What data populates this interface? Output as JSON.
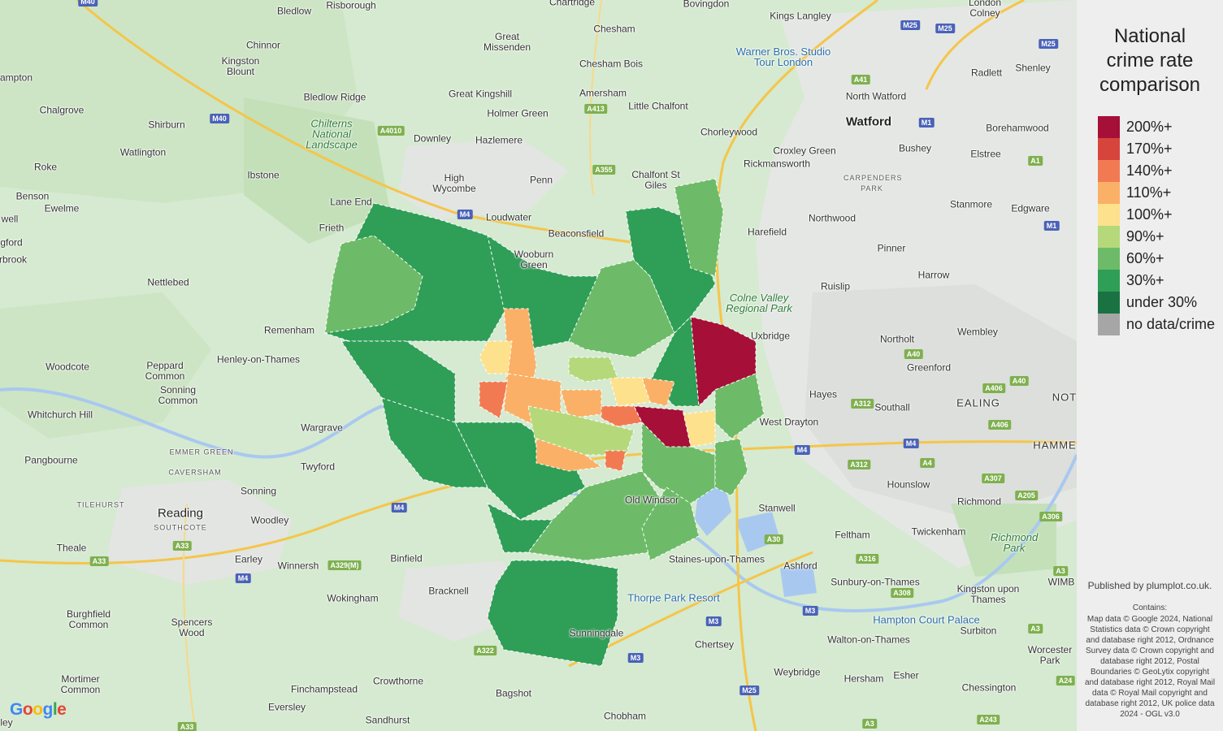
{
  "legend": {
    "title_lines": [
      "National",
      "crime rate",
      "comparison"
    ],
    "items": [
      {
        "label": "200%+",
        "color": "#a50f38"
      },
      {
        "label": "170%+",
        "color": "#d7443c"
      },
      {
        "label": "140%+",
        "color": "#f27a52"
      },
      {
        "label": "110%+",
        "color": "#fbb067"
      },
      {
        "label": "100%+",
        "color": "#fde18c"
      },
      {
        "label": "90%+",
        "color": "#b5d97a"
      },
      {
        "label": "60%+",
        "color": "#6dbb68"
      },
      {
        "label": "30%+",
        "color": "#2f9e57"
      },
      {
        "label": "under 30%",
        "color": "#1a7242"
      },
      {
        "label": "no data/crime",
        "color": "#a6a6a6"
      }
    ]
  },
  "published": "Published by plumplot.co.uk.",
  "contains_heading": "Contains:",
  "attribution": "Map data © Google 2024, National Statistics data © Crown copyright and database right 2012, Ordnance Survey data © Crown copyright and database right 2012, Postal Boundaries © GeoLytix copyright and database right 2012, Royal Mail data © Royal Mail copyright and database right 2012, UK police data 2024 - OGL v3.0",
  "google_logo": [
    "G",
    "o",
    "o",
    "g",
    "l",
    "e"
  ],
  "map_labels": [
    {
      "text": "Bledlow"
    },
    {
      "text": "Risborough"
    },
    {
      "text": "Chinnor"
    },
    {
      "text": "Kingston Blount"
    },
    {
      "text": "ampton"
    },
    {
      "text": "Chalgrove"
    },
    {
      "text": "Shirburn"
    },
    {
      "text": "Watlington"
    },
    {
      "text": "Roke"
    },
    {
      "text": "Benson"
    },
    {
      "text": "Ewelme"
    },
    {
      "text": "Ibstone"
    },
    {
      "text": "Bledlow Ridge"
    },
    {
      "text": "Great Missenden"
    },
    {
      "text": "Chesham"
    },
    {
      "text": "Chesham Bois"
    },
    {
      "text": "Amersham"
    },
    {
      "text": "Little Chalfont"
    },
    {
      "text": "Great Kingshill"
    },
    {
      "text": "Holmer Green"
    },
    {
      "text": "Hazlemere"
    },
    {
      "text": "Downley"
    },
    {
      "text": "High Wycombe"
    },
    {
      "text": "Penn"
    },
    {
      "text": "Lane End"
    },
    {
      "text": "Loudwater"
    },
    {
      "text": "Beaconsfield"
    },
    {
      "text": "Frieth"
    },
    {
      "text": "Wooburn Green"
    },
    {
      "text": "Chalfont St Giles"
    },
    {
      "text": "Chorleywood"
    },
    {
      "text": "Croxley Green"
    },
    {
      "text": "Rickmansworth"
    },
    {
      "text": "Watford"
    },
    {
      "text": "North Watford"
    },
    {
      "text": "Kings Langley"
    },
    {
      "text": "Bovingdon"
    },
    {
      "text": "Chartridge"
    },
    {
      "text": "Radlett"
    },
    {
      "text": "Shenley"
    },
    {
      "text": "Borehamwood"
    },
    {
      "text": "Bushey"
    },
    {
      "text": "Elstree"
    },
    {
      "text": "Stanmore"
    },
    {
      "text": "Edgware"
    },
    {
      "text": "Northwood"
    },
    {
      "text": "Harefield"
    },
    {
      "text": "Pinner"
    },
    {
      "text": "Harrow"
    },
    {
      "text": "Ruislip"
    },
    {
      "text": "Uxbridge"
    },
    {
      "text": "Northolt"
    },
    {
      "text": "Wembley"
    },
    {
      "text": "Greenford"
    },
    {
      "text": "Hayes"
    },
    {
      "text": "Southall"
    },
    {
      "text": "EALING"
    },
    {
      "text": "NOT"
    },
    {
      "text": "West Drayton"
    },
    {
      "text": "HAMME"
    },
    {
      "text": "Hounslow"
    },
    {
      "text": "Stanwell"
    },
    {
      "text": "Richmond"
    },
    {
      "text": "Feltham"
    },
    {
      "text": "Twickenham"
    },
    {
      "text": "Richmond Park"
    },
    {
      "text": "Ashford"
    },
    {
      "text": "Staines-upon-Thames"
    },
    {
      "text": "Sunbury-on-Thames"
    },
    {
      "text": "Kingston upon Thames"
    },
    {
      "text": "WIMB"
    },
    {
      "text": "Hampton Court Palace"
    },
    {
      "text": "Surbiton"
    },
    {
      "text": "Walton-on-Thames"
    },
    {
      "text": "Chertsey"
    },
    {
      "text": "Thorpe Park Resort"
    },
    {
      "text": "Weybridge"
    },
    {
      "text": "Hersham"
    },
    {
      "text": "Esher"
    },
    {
      "text": "Worcester Park"
    },
    {
      "text": "Chessington"
    },
    {
      "text": "Chobham"
    },
    {
      "text": "Bagshot"
    },
    {
      "text": "Sandhurst"
    },
    {
      "text": "Crowthorne"
    },
    {
      "text": "Eversley"
    },
    {
      "text": "Finchampstead"
    },
    {
      "text": "Bracknell"
    },
    {
      "text": "Binfield"
    },
    {
      "text": "Wokingham"
    },
    {
      "text": "Winnersh"
    },
    {
      "text": "Woodley"
    },
    {
      "text": "Reading"
    },
    {
      "text": "SOUTHCOTE"
    },
    {
      "text": "TILEHURST"
    },
    {
      "text": "Theale"
    },
    {
      "text": "Earley"
    },
    {
      "text": "Sonning"
    },
    {
      "text": "Twyford"
    },
    {
      "text": "Wargrave"
    },
    {
      "text": "CAVERSHAM"
    },
    {
      "text": "EMMER GREEN"
    },
    {
      "text": "Pangbourne"
    },
    {
      "text": "Whitchurch Hill"
    },
    {
      "text": "Woodcote"
    },
    {
      "text": "Peppard Common"
    },
    {
      "text": "Sonning Common"
    },
    {
      "text": "Henley-on-Thames"
    },
    {
      "text": "Remenham"
    },
    {
      "text": "Nettlebed"
    },
    {
      "text": "Burghfield Common"
    },
    {
      "text": "Mortimer Common"
    },
    {
      "text": "Spencers Wood"
    },
    {
      "text": "ley"
    },
    {
      "text": "well"
    },
    {
      "text": "gford"
    },
    {
      "text": "rbrook"
    },
    {
      "text": "Chilterns National Landscape"
    },
    {
      "text": "Colne Valley Regional Park"
    },
    {
      "text": "Warner Bros. Studio Tour London"
    },
    {
      "text": "CARPENDERS PARK"
    },
    {
      "text": "London Colney"
    },
    {
      "text": "Old Windsor"
    },
    {
      "text": "Sunningdale"
    }
  ],
  "road_shields": [
    {
      "text": "M40"
    },
    {
      "text": "M40"
    },
    {
      "text": "A4010"
    },
    {
      "text": "A413"
    },
    {
      "text": "A355"
    },
    {
      "text": "M25"
    },
    {
      "text": "M25"
    },
    {
      "text": "M25"
    },
    {
      "text": "A41"
    },
    {
      "text": "M1"
    },
    {
      "text": "A1"
    },
    {
      "text": "M1"
    },
    {
      "text": "A40"
    },
    {
      "text": "A40"
    },
    {
      "text": "A406"
    },
    {
      "text": "A406"
    },
    {
      "text": "A312"
    },
    {
      "text": "M4"
    },
    {
      "text": "M4"
    },
    {
      "text": "A4"
    },
    {
      "text": "A312"
    },
    {
      "text": "A307"
    },
    {
      "text": "A205"
    },
    {
      "text": "A306"
    },
    {
      "text": "A30"
    },
    {
      "text": "A316"
    },
    {
      "text": "A308"
    },
    {
      "text": "A3"
    },
    {
      "text": "M3"
    },
    {
      "text": "M3"
    },
    {
      "text": "M3"
    },
    {
      "text": "A3"
    },
    {
      "text": "A24"
    },
    {
      "text": "A243"
    },
    {
      "text": "M25"
    },
    {
      "text": "A3"
    },
    {
      "text": "M4"
    },
    {
      "text": "M4"
    },
    {
      "text": "A33"
    },
    {
      "text": "A329(M)"
    },
    {
      "text": "M4"
    },
    {
      "text": "A33"
    },
    {
      "text": "A33"
    },
    {
      "text": "A322"
    }
  ]
}
